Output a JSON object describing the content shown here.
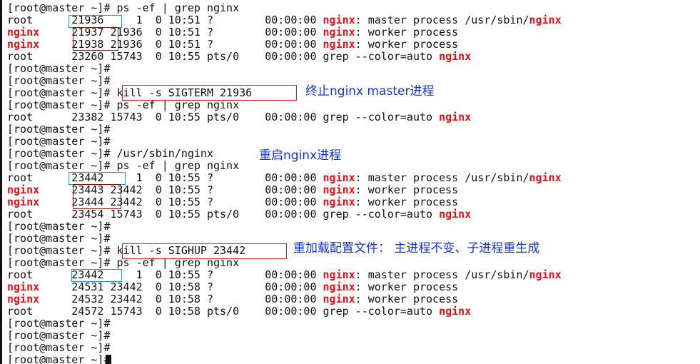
{
  "colors": {
    "background": "#ffffff",
    "text": "#111111",
    "highlight": "#e8101a",
    "note": "#1533d6",
    "box_blue": "#1a9ad6",
    "box_dark": "#7a1a1a",
    "box_red": "#d91c1c"
  },
  "lines": [
    [
      {
        "t": "[root@master ~]# ps -ef | grep nginx"
      }
    ],
    [
      {
        "t": "root      21936     1  0 10:51 ?        00:00:00 "
      },
      {
        "t": "nginx",
        "hl": true
      },
      {
        "t": ": master process /usr/sbin/"
      },
      {
        "t": "nginx",
        "hl": true
      }
    ],
    [
      {
        "t": "nginx",
        "hl": true
      },
      {
        "t": "     21937 21936  0 10:51 ?        00:00:00 "
      },
      {
        "t": "nginx",
        "hl": true
      },
      {
        "t": ": worker process"
      }
    ],
    [
      {
        "t": "nginx",
        "hl": true
      },
      {
        "t": "     21938 21936  0 10:51 ?        00:00:00 "
      },
      {
        "t": "nginx",
        "hl": true
      },
      {
        "t": ": worker process"
      }
    ],
    [
      {
        "t": "root      23260 15743  0 10:55 pts/0    00:00:00 grep --color=auto "
      },
      {
        "t": "nginx",
        "hl": true
      }
    ],
    [
      {
        "t": "[root@master ~]#"
      }
    ],
    [
      {
        "t": "[root@master ~]#"
      }
    ],
    [
      {
        "t": "[root@master ~]# kill -s SIGTERM 21936"
      }
    ],
    [
      {
        "t": "[root@master ~]# ps -ef | grep nginx"
      }
    ],
    [
      {
        "t": "root      23382 15743  0 10:55 pts/0    00:00:00 grep --color=auto "
      },
      {
        "t": "nginx",
        "hl": true
      }
    ],
    [
      {
        "t": "[root@master ~]#"
      }
    ],
    [
      {
        "t": "[root@master ~]#"
      }
    ],
    [
      {
        "t": "[root@master ~]# /usr/sbin/nginx"
      }
    ],
    [
      {
        "t": "[root@master ~]# ps -ef | grep nginx"
      }
    ],
    [
      {
        "t": "root      23442     1  0 10:55 ?        00:00:00 "
      },
      {
        "t": "nginx",
        "hl": true
      },
      {
        "t": ": master process /usr/sbin/"
      },
      {
        "t": "nginx",
        "hl": true
      }
    ],
    [
      {
        "t": "nginx",
        "hl": true
      },
      {
        "t": "     23443 23442  0 10:55 ?        00:00:00 "
      },
      {
        "t": "nginx",
        "hl": true
      },
      {
        "t": ": worker process"
      }
    ],
    [
      {
        "t": "nginx",
        "hl": true
      },
      {
        "t": "     23444 23442  0 10:55 ?        00:00:00 "
      },
      {
        "t": "nginx",
        "hl": true
      },
      {
        "t": ": worker process"
      }
    ],
    [
      {
        "t": "root      23454 15743  0 10:55 pts/0    00:00:00 grep --color=auto "
      },
      {
        "t": "nginx",
        "hl": true
      }
    ],
    [
      {
        "t": "[root@master ~]#"
      }
    ],
    [
      {
        "t": "[root@master ~]#"
      }
    ],
    [
      {
        "t": "[root@master ~]# kill -s SIGHUP 23442"
      }
    ],
    [
      {
        "t": "[root@master ~]# ps -ef | grep nginx"
      }
    ],
    [
      {
        "t": "root      23442     1  0 10:55 ?        00:00:00 "
      },
      {
        "t": "nginx",
        "hl": true
      },
      {
        "t": ": master process /usr/sbin/"
      },
      {
        "t": "nginx",
        "hl": true
      }
    ],
    [
      {
        "t": "nginx",
        "hl": true
      },
      {
        "t": "     24531 23442  0 10:58 ?        00:00:00 "
      },
      {
        "t": "nginx",
        "hl": true
      },
      {
        "t": ": worker process"
      }
    ],
    [
      {
        "t": "nginx",
        "hl": true
      },
      {
        "t": "     24532 23442  0 10:58 ?        00:00:00 "
      },
      {
        "t": "nginx",
        "hl": true
      },
      {
        "t": ": worker process"
      }
    ],
    [
      {
        "t": "root      24572 15743  0 10:58 pts/0    00:00:00 grep --color=auto "
      },
      {
        "t": "nginx",
        "hl": true
      }
    ],
    [
      {
        "t": "[root@master ~]#"
      }
    ],
    [
      {
        "t": "[root@master ~]#"
      }
    ],
    [
      {
        "t": "[root@master ~]#"
      }
    ],
    [
      {
        "t": "[root@master ~]#"
      }
    ]
  ],
  "annotations": {
    "note_stop_master": "终止nginx master进程",
    "note_restart": "重启nginx进程",
    "note_reload": "重加载配置文件： 主进程不变、子进程重生成"
  }
}
